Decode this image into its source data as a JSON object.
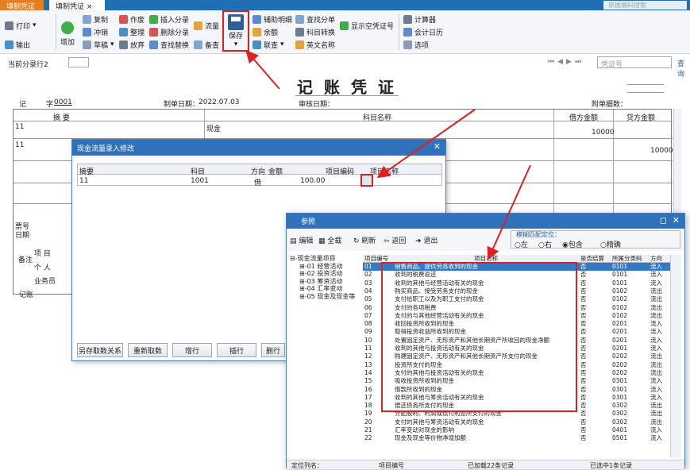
{
  "tabs": {
    "active_left": "填制凭证",
    "tab2": "填制凭证"
  },
  "search": {
    "placeholder": "单据编码搜索"
  },
  "ribbon": {
    "print": "打印",
    "export": "输出",
    "add": "增加",
    "copy": "复制",
    "reverse": "冲销",
    "draft": "草稿",
    "void": "作废",
    "sort": "整理",
    "abandon": "放弃",
    "insert_entry": "插入分录",
    "delete_entry": "删除分录",
    "find_replace": "查找替换",
    "flow": "流量",
    "memo": "备查",
    "save": "保存",
    "aux_detail": "辅助明细",
    "balance": "余额",
    "link": "联查",
    "find_doc": "查找分单",
    "subject_convert": "科目转换",
    "en_name": "英文名称",
    "show_empty": "显示空凭证号",
    "calculator": "计算器",
    "calendar": "会计日历",
    "options": "选项"
  },
  "status": {
    "current_entry_label": "当前分录行2",
    "voucher_no_placeholder": "凭证号",
    "query": "查询"
  },
  "voucher": {
    "title": "记账凭证",
    "type_label": "记",
    "no_label": "字",
    "no_value": "0001",
    "date_label": "制单日期：",
    "date_value": "2022.07.03",
    "audit_label": "审核日期：",
    "attach_label": "附单据数：",
    "col_summary": "摘 要",
    "col_subject": "科目名称",
    "col_debit": "借方金额",
    "col_credit": "贷方金额",
    "row1_summary": "11",
    "row1_subject": "现金",
    "row1_debit": "10000",
    "row2_summary": "11",
    "row2_credit": "10000",
    "ticket_label": "票号",
    "date2_label": "日期",
    "note_label": "备注",
    "project_label": "项  目",
    "person_label": "个  人",
    "sales_label": "业务员",
    "bookkeep_label": "记账"
  },
  "dialog1": {
    "title": "现金流量录入修改",
    "headers": [
      "摘要",
      "科目",
      "方向",
      "金额",
      "项目编码",
      "项目名称"
    ],
    "row": {
      "summary": "11",
      "subject": "1001",
      "dir": "借",
      "amount": "100.00"
    },
    "buttons": [
      "另存取数关系",
      "重新取数",
      "增行",
      "插行",
      "删行"
    ]
  },
  "dialog2": {
    "title": "参照",
    "toolbar": [
      "编辑",
      "全载",
      "刷新",
      "返回",
      "退出"
    ],
    "match_label": "模糊匹配定位：",
    "match_options": [
      "左",
      "右",
      "包含",
      "精确"
    ],
    "tree": [
      "现金流量项目",
      "01 经营活动",
      "02 投资活动",
      "03 筹资活动",
      "04 汇率变动",
      "05 现金及现金等"
    ],
    "headers": [
      "项目编号",
      "项目名称",
      "是否结算",
      "所属分类码",
      "方向"
    ],
    "rows": [
      [
        "01",
        "销售商品、提供劳务收到的现金",
        "否",
        "0101",
        "流入"
      ],
      [
        "02",
        "收到的税费返还",
        "否",
        "0101",
        "流入"
      ],
      [
        "03",
        "收到的其他与经营活动有关的现金",
        "否",
        "0101",
        "流入"
      ],
      [
        "04",
        "购买商品、接受劳务支付的现金",
        "否",
        "0102",
        "流出"
      ],
      [
        "05",
        "支付给职工以及为职工支付的现金",
        "否",
        "0102",
        "流出"
      ],
      [
        "06",
        "支付的各项税费",
        "否",
        "0102",
        "流出"
      ],
      [
        "07",
        "支付的与其他经营活动有关的现金",
        "否",
        "0102",
        "流出"
      ],
      [
        "08",
        "收回投资所收到的现金",
        "否",
        "0201",
        "流入"
      ],
      [
        "09",
        "取得投资收益所收到的现金",
        "否",
        "0201",
        "流入"
      ],
      [
        "10",
        "处置固定资产、无形资产和其他长期资产所收回的现金净额",
        "否",
        "0201",
        "流入"
      ],
      [
        "11",
        "收到的其他与投资活动有关的现金",
        "否",
        "0201",
        "流入"
      ],
      [
        "12",
        "购建固定资产、无形资产和其他长期资产所支付的现金",
        "否",
        "0202",
        "流出"
      ],
      [
        "13",
        "投资所支付的现金",
        "否",
        "0202",
        "流出"
      ],
      [
        "14",
        "支付的其他与投资活动有关的现金",
        "否",
        "0202",
        "流出"
      ],
      [
        "15",
        "吸收投资所收到的现金",
        "否",
        "0301",
        "流入"
      ],
      [
        "16",
        "借款所收到的现金",
        "否",
        "0301",
        "流入"
      ],
      [
        "17",
        "收到的其他与筹资活动有关的现金",
        "否",
        "0301",
        "流入"
      ],
      [
        "18",
        "偿还债务所支付的现金",
        "否",
        "0302",
        "流出"
      ],
      [
        "19",
        "分配股利、利润或偿付利息所支付的现金",
        "否",
        "0302",
        "流出"
      ],
      [
        "20",
        "支付的其他与筹资活动有关的现金",
        "否",
        "0302",
        "流出"
      ],
      [
        "21",
        "汇率变动对现金的影响",
        "否",
        "0401",
        "流入"
      ],
      [
        "22",
        "现金及现金等价物净增加额",
        "否",
        "0501",
        "流入"
      ]
    ],
    "footer": [
      "定位列名：",
      "项目编号",
      "已加载22条记录",
      "已选中1条记录"
    ]
  }
}
